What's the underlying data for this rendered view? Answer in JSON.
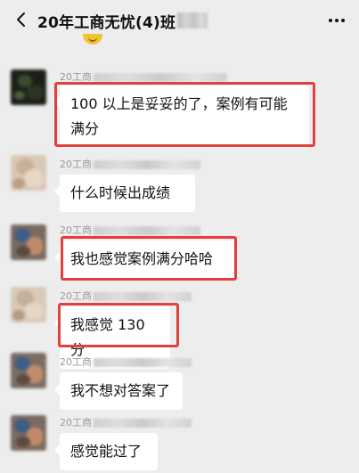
{
  "header": {
    "title": "20年工商无忧(4)班",
    "back_icon": "chevron-left-icon",
    "more_icon": "more-dots-icon"
  },
  "colors": {
    "background": "#ededed",
    "bubble": "#ffffff",
    "highlight": "#e2403c",
    "sender_text": "#9a9a9a"
  },
  "messages": [
    {
      "sender": "20工商",
      "text": "100 以上是妥妥的了，案例有可能满分",
      "highlighted": true
    },
    {
      "sender": "20工商",
      "text": "什么时候出成绩",
      "highlighted": false
    },
    {
      "sender": "20工商",
      "text": "我也感觉案例满分哈哈",
      "highlighted": true
    },
    {
      "sender": "20工商",
      "text": "我感觉 130 分",
      "highlighted": true
    },
    {
      "sender": "20工商",
      "text": "我不想对答案了",
      "highlighted": false
    },
    {
      "sender": "20工商",
      "text": "感觉能过了",
      "highlighted": false
    }
  ]
}
